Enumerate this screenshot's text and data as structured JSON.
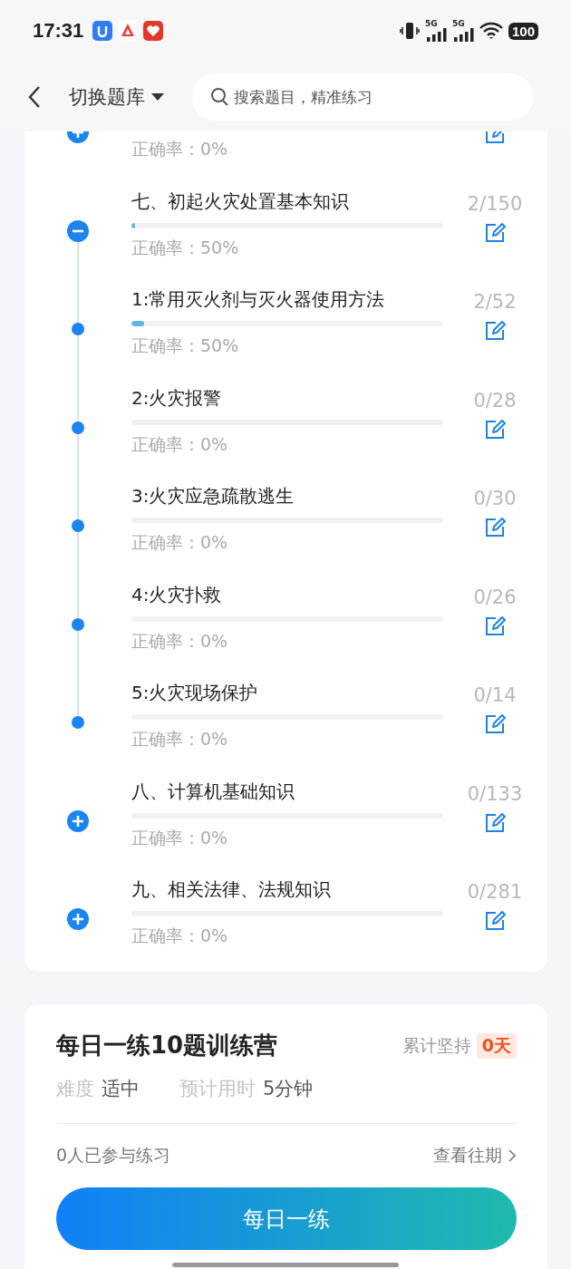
{
  "status_bar": {
    "time": "17:31",
    "networks": [
      "5G",
      "5G"
    ],
    "battery": "100"
  },
  "header": {
    "title": "切换题库",
    "search": {
      "placeholder": "搜索题目，精准练习"
    }
  },
  "chapters": [
    {
      "accuracy": "正确率：0%",
      "expanded": false
    },
    {
      "title": "七、初起火灾处置基本知识",
      "count": "2/150",
      "accuracy": "正确率：50%",
      "level": 0.013,
      "expanded": true,
      "children": [
        {
          "title": "1:常用灭火剂与灭火器使用方法",
          "count": "2/52",
          "accuracy": "正确率：50%",
          "level": 0.04
        },
        {
          "title": "2:火灾报警",
          "count": "0/28",
          "accuracy": "正确率：0%",
          "level": 0
        },
        {
          "title": "3:火灾应急疏散逃生",
          "count": "0/30",
          "accuracy": "正确率：0%",
          "level": 0
        },
        {
          "title": "4:火灾扑救",
          "count": "0/26",
          "accuracy": "正确率：0%",
          "level": 0
        },
        {
          "title": "5:火灾现场保护",
          "count": "0/14",
          "accuracy": "正确率：0%",
          "level": 0
        }
      ]
    },
    {
      "title": "八、计算机基础知识",
      "count": "0/133",
      "accuracy": "正确率：0%",
      "level": 0,
      "expanded": false
    },
    {
      "title": "九、相关法律、法规知识",
      "count": "0/281",
      "accuracy": "正确率：0%",
      "level": 0,
      "expanded": false
    }
  ],
  "camp": {
    "title": "每日一练10题训练营",
    "streak_label": "累计坚持",
    "streak": "0天",
    "difficulty_label": "难度",
    "difficulty": "适中",
    "time_label": "预计用时",
    "time": "5分钟",
    "participants": "0人已参与练习",
    "history_link": "查看往期",
    "button": "每日一练"
  }
}
